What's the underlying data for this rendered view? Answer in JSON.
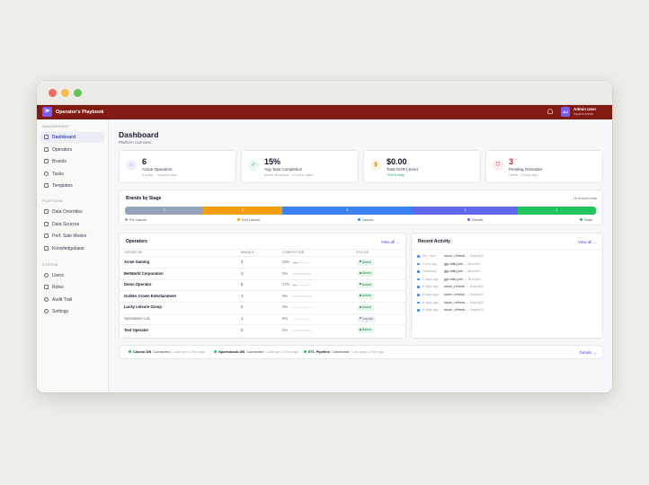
{
  "window": {
    "dots": [
      "#ee6a5f",
      "#f5bd4f",
      "#61c454"
    ]
  },
  "topbar": {
    "logo_glyph": "≫",
    "title": "Operator's Playbook",
    "bell_icon": "bell-icon",
    "user": {
      "initials": "AU",
      "name": "Admin User",
      "role": "System Admin"
    }
  },
  "sidebar": {
    "sections": [
      {
        "label": "MANAGEMENT",
        "items": [
          {
            "label": "Dashboard",
            "icon": "home-icon",
            "active": true
          },
          {
            "label": "Operators",
            "icon": "users-icon"
          },
          {
            "label": "Brands",
            "icon": "tag-icon"
          },
          {
            "label": "Tasks",
            "icon": "check-circle-icon"
          },
          {
            "label": "Templates",
            "icon": "file-icon"
          }
        ]
      },
      {
        "label": "PLATFORM",
        "items": [
          {
            "label": "Data Overrides",
            "icon": "git-branch-icon"
          },
          {
            "label": "Data Sources",
            "icon": "database-icon"
          },
          {
            "label": "Perf. Sale Modes",
            "icon": "sliders-icon"
          },
          {
            "label": "Knowledgebase",
            "icon": "book-icon"
          }
        ]
      },
      {
        "label": "SYSTEM",
        "items": [
          {
            "label": "Users",
            "icon": "user-icon"
          },
          {
            "label": "Roles",
            "icon": "key-icon"
          },
          {
            "label": "Audit Trail",
            "icon": "history-icon"
          },
          {
            "label": "Settings",
            "icon": "gear-icon"
          }
        ]
      }
    ]
  },
  "main": {
    "title": "Dashboard",
    "subtitle": "Platform overview",
    "kpis": [
      {
        "value": "6",
        "label": "Active Operators",
        "sub": "6 active · 1 inactive total",
        "icon": "home-icon",
        "color": "#6366f1",
        "bg": "#eef0fe"
      },
      {
        "value": "15%",
        "label": "Avg Task Completion",
        "sub": "across all brands · 10 active tasks",
        "icon": "check-circle-icon",
        "color": "#16a34a",
        "bg": "#e8f7ed"
      },
      {
        "value": "$0.00",
        "label": "Total GGR (June)",
        "sub": "+0% vs May",
        "sub_color": "#16a34a",
        "icon": "dollar-icon",
        "color": "#d97706",
        "bg": "#fdf3dc"
      },
      {
        "value": "3",
        "label": "Pending Overrides",
        "sub": "Oldest: 73 days ago",
        "icon": "shield-icon",
        "color": "#dc2626",
        "bg": "#fdecec",
        "value_color": "#dc2626"
      }
    ],
    "brands_by_stage": {
      "title": "Brands by Stage",
      "total": "18 brands total",
      "stages": [
        {
          "name": "Pre Launch",
          "count": "3",
          "color": "#94a3b8",
          "share": 3
        },
        {
          "name": "Soft Launch",
          "count": "3",
          "color": "#f59e0b",
          "share": 3
        },
        {
          "name": "Launch",
          "count": "5",
          "color": "#3b82f6",
          "share": 5
        },
        {
          "name": "Growth",
          "count": "4",
          "color": "#6366f1",
          "share": 4
        },
        {
          "name": "Scale",
          "count": "3",
          "color": "#22c55e",
          "share": 3
        }
      ]
    },
    "operators": {
      "title": "Operators",
      "view_all": "View all →",
      "columns": [
        "OPERATOR",
        "BRANDS",
        "COMPLETION",
        "STATUS"
      ],
      "rows": [
        {
          "name": "Acme Gaming",
          "brands": "3",
          "completion": "25%",
          "pct": 25,
          "status": "Active"
        },
        {
          "name": "BetWorld Corporation",
          "brands": "3",
          "completion": "0%",
          "pct": 0,
          "status": "Active"
        },
        {
          "name": "Demo Operator",
          "brands": "6",
          "completion": "17%",
          "pct": 17,
          "status": "Active"
        },
        {
          "name": "Golden Crown Entertainment",
          "brands": "1",
          "completion": "0%",
          "pct": 0,
          "status": "Active"
        },
        {
          "name": "Lucky Leisure Group",
          "brands": "2",
          "completion": "0%",
          "pct": 0,
          "status": "Active"
        },
        {
          "name": "SpinMaster Ltd",
          "brands": "1",
          "completion": "0%",
          "pct": 0,
          "status": "Inactive"
        },
        {
          "name": "Test Operator",
          "brands": "0",
          "completion": "0%",
          "pct": 0,
          "status": "Active"
        }
      ]
    },
    "activity": {
      "title": "Recent Activity",
      "view_all": "View all →",
      "items": [
        {
          "time": "5m+ now",
          "text": "token_refresh",
          "tail": "— Brand#3"
        },
        {
          "time": "1 h+s ago",
          "text": "ggr.daily.pull",
          "tail": "— Brand#1"
        },
        {
          "time": "Yesterday",
          "text": "ggr.daily.pull",
          "tail": "— Brand#1"
        },
        {
          "time": "2 days ago",
          "text": "ggr.daily.pull",
          "tail": "— Brand#1"
        },
        {
          "time": "5 days ago",
          "text": "token_refresh",
          "tail": "— Brand#3"
        },
        {
          "time": "5 days ago",
          "text": "token_refresh",
          "tail": "— Brand#3"
        },
        {
          "time": "5 days ago",
          "text": "token_refresh",
          "tail": "— Brand#3"
        },
        {
          "time": "5 days ago",
          "text": "token_refresh",
          "tail": "— Brand#3"
        }
      ]
    },
    "system": {
      "items": [
        {
          "name": "Casino DB",
          "state": "Connected",
          "sync": "Last sync 17hrs ago"
        },
        {
          "name": "Sportsbook DB",
          "state": "Connected",
          "sync": "Last sync 17hrs ago"
        },
        {
          "name": "ETL Pipeline",
          "state": "Connected",
          "sync": "Last sync 17hrs ago"
        }
      ],
      "details": "Details →"
    }
  }
}
